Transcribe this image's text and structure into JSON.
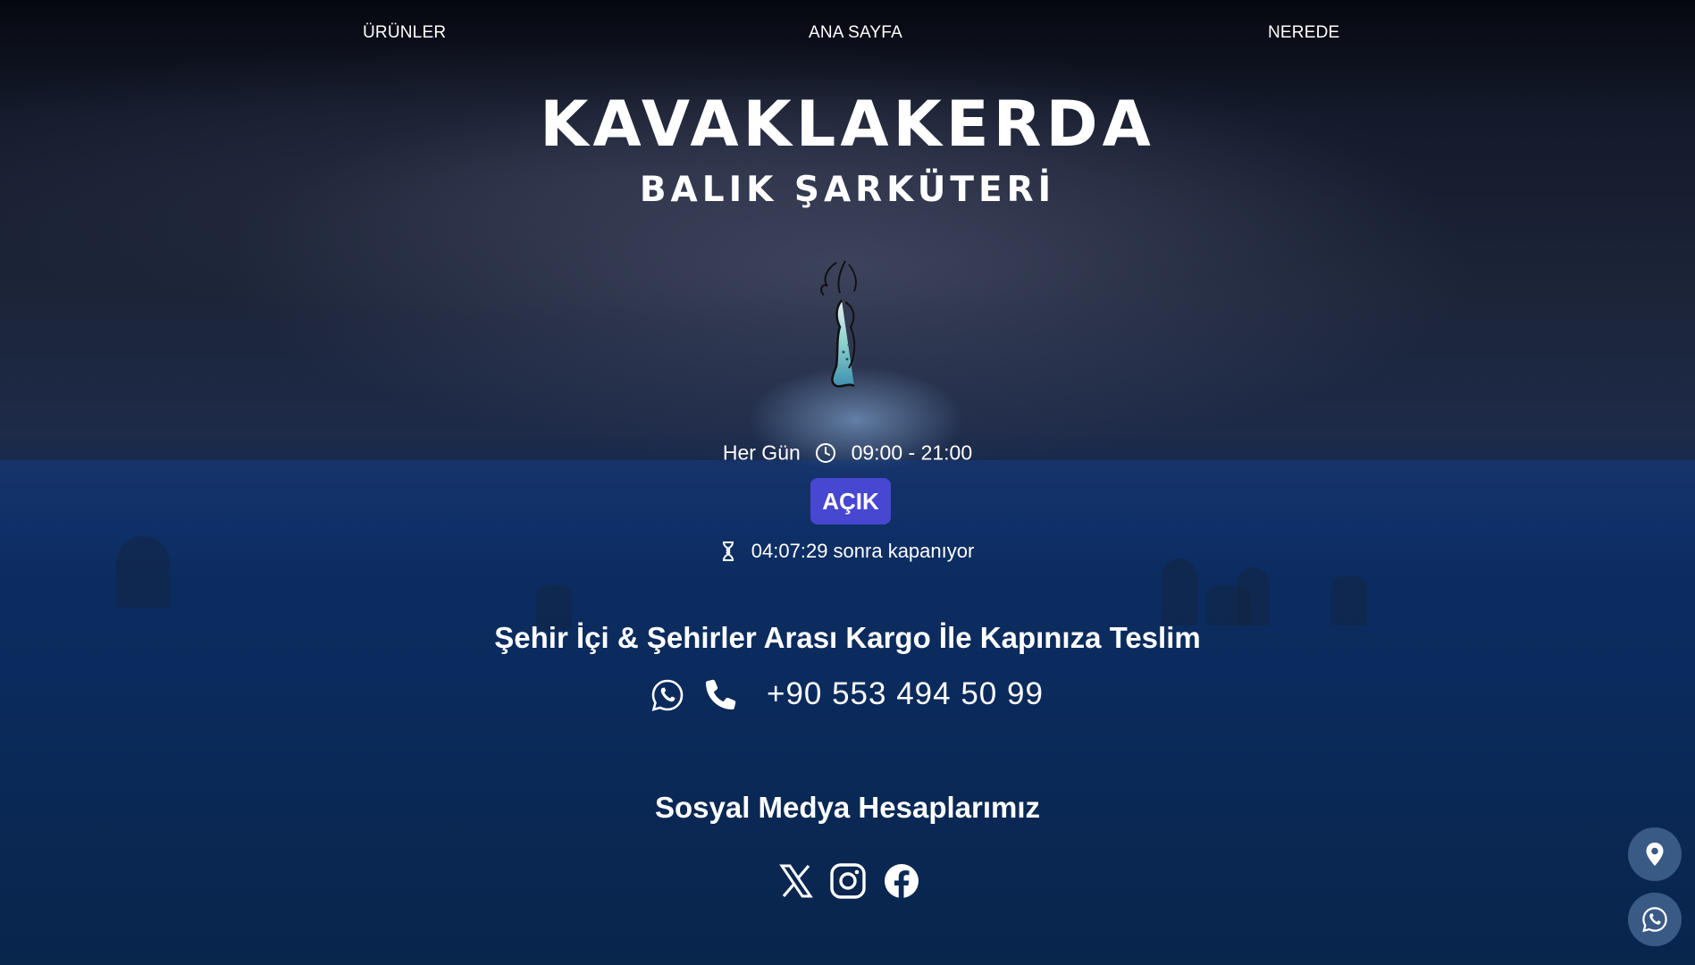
{
  "nav": {
    "products_label": "ÜRÜNLER",
    "home_label": "ANA SAYFA",
    "where_label": "NEREDE"
  },
  "hero": {
    "brand": "KAVAKLAKERDA",
    "subtitle": "BALIK ŞARKÜTERİ",
    "logo_icon": "mermaid-logo"
  },
  "hours": {
    "days": "Her Gün",
    "time": "09:00 - 21:00",
    "icon": "clock-icon"
  },
  "status": {
    "label": "AÇIK",
    "color": "#4847d2"
  },
  "countdown": {
    "text": "04:07:29 sonra kapanıyor",
    "icon": "hourglass-icon"
  },
  "delivery": {
    "text": "Şehir İçi & Şehirler Arası Kargo İle Kapınıza Teslim"
  },
  "contact": {
    "phone": "+90 553 494 50 99",
    "icons": [
      "whatsapp-icon",
      "phone-icon"
    ]
  },
  "social": {
    "title": "Sosyal Medya Hesaplarımız",
    "icons": [
      "x-icon",
      "instagram-icon",
      "facebook-icon"
    ]
  },
  "floating": {
    "icons": [
      "location-pin-icon",
      "whatsapp-icon"
    ],
    "color": "#3a5a86"
  }
}
